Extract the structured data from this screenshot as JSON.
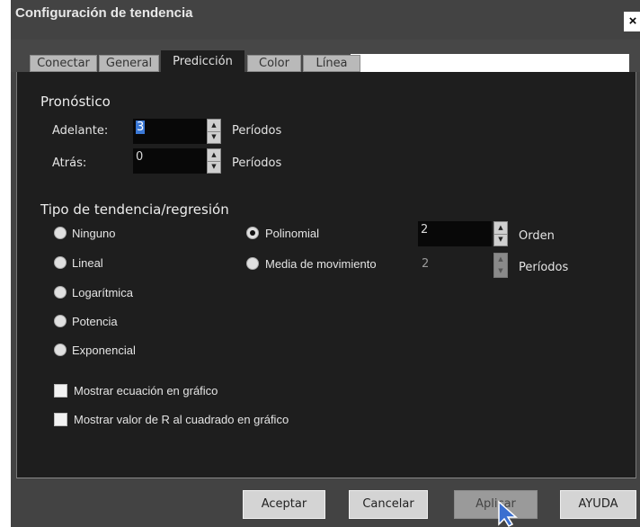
{
  "dialog": {
    "title": "Configuración de tendencia",
    "close_glyph": "×"
  },
  "tabs": [
    {
      "label": "Conectar",
      "active": false
    },
    {
      "label": "General",
      "active": false
    },
    {
      "label": "Predicción",
      "active": true
    },
    {
      "label": "Color",
      "active": false
    },
    {
      "label": "Línea",
      "active": false
    }
  ],
  "forecast": {
    "heading": "Pronóstico",
    "forward_label": "Adelante:",
    "forward_value": "3",
    "backward_label": "Atrás:",
    "backward_value": "0",
    "periods_label": "Períodos"
  },
  "trend": {
    "heading": "Tipo de tendencia/regresión",
    "options": [
      "Ninguno",
      "Lineal",
      "Logarítmica",
      "Potencia",
      "Exponencial",
      "Polinomial",
      "Media de movimiento"
    ],
    "selected": "Polinomial",
    "order_value": "2",
    "order_label": "Orden",
    "moving_value": "2",
    "moving_label": "Períodos"
  },
  "checkboxes": {
    "show_equation": "Mostrar ecuación en gráfico",
    "show_r2": "Mostrar valor de R al cuadrado en gráfico"
  },
  "buttons": {
    "ok": "Aceptar",
    "cancel": "Cancelar",
    "apply": "Aplicar",
    "help": "AYUDA"
  },
  "colors": {
    "panel": "#1e1e1e",
    "frame": "#434343",
    "tab_inactive": "#b9b9b9",
    "button": "#d4d4d4"
  },
  "icons": {
    "spin_up": "▲",
    "spin_down": "▼",
    "cursor": "mouse-pointer-icon"
  }
}
